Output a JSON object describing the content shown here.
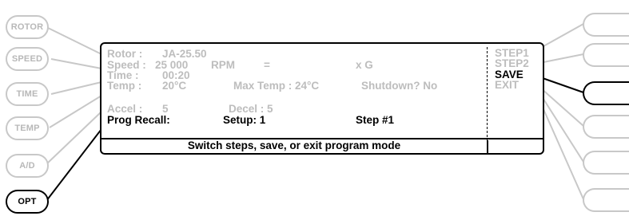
{
  "left_buttons": [
    {
      "name": "rotor-button",
      "label": "ROTOR",
      "active": false
    },
    {
      "name": "speed-button",
      "label": "SPEED",
      "active": false
    },
    {
      "name": "time-button",
      "label": "TIME",
      "active": false
    },
    {
      "name": "temp-button",
      "label": "TEMP",
      "active": false
    },
    {
      "name": "ad-button",
      "label": "A/D",
      "active": false
    },
    {
      "name": "opt-button",
      "label": "OPT",
      "active": true
    }
  ],
  "display": {
    "rotor_label": "Rotor :",
    "rotor_value": "JA-25.50",
    "speed_label": "Speed :",
    "speed_value": "25 000",
    "speed_unit": "RPM",
    "equals": "=",
    "xg": "x G",
    "time_label": "Time :",
    "time_value": "00:20",
    "temp_label": "Temp :",
    "temp_value": "20°C",
    "max_temp": "Max Temp : 24°C",
    "shutdown": "Shutdown? No",
    "accel_label": "Accel :",
    "accel_value": "5",
    "decel": "Decel : 5",
    "prog_recall": "Prog Recall:",
    "setup": "Setup: 1",
    "step": "Step #1",
    "status_message": "Switch steps, save, or exit program mode"
  },
  "softkeys": [
    {
      "label": "STEP1",
      "active": false
    },
    {
      "label": "STEP2",
      "active": false
    },
    {
      "label": "SAVE",
      "active": true
    },
    {
      "label": "EXIT",
      "active": false
    }
  ],
  "colors": {
    "active": "#000000",
    "inactive": "#bdbdbd"
  }
}
